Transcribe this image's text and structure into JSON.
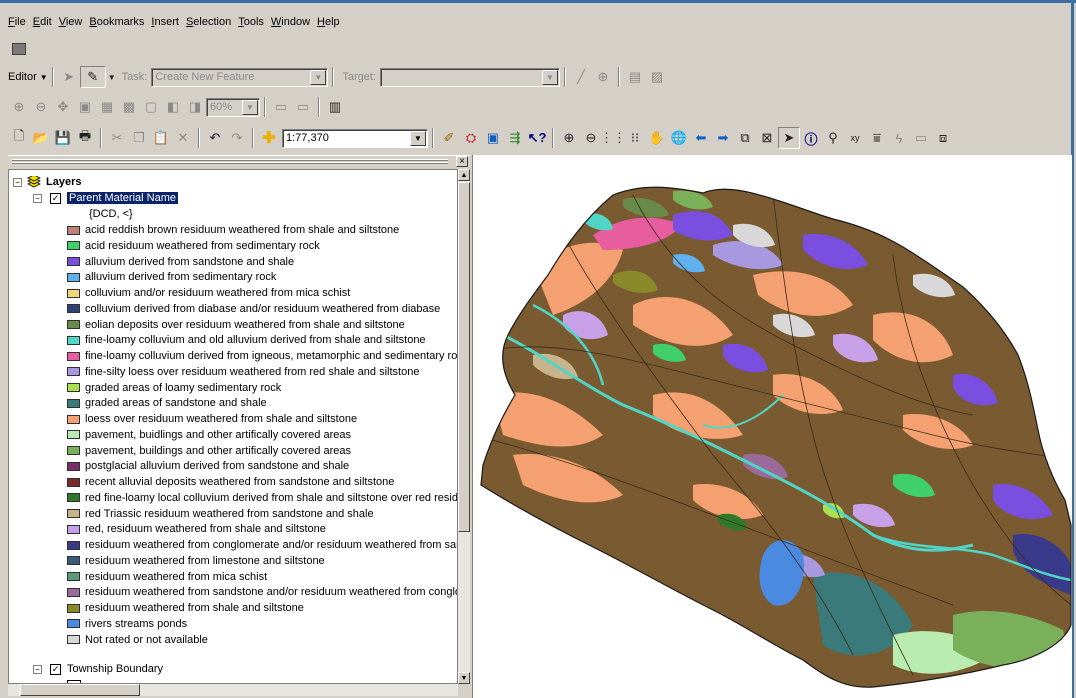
{
  "menu": [
    "File",
    "Edit",
    "View",
    "Bookmarks",
    "Insert",
    "Selection",
    "Tools",
    "Window",
    "Help"
  ],
  "editor_toolbar": {
    "editor_label": "Editor",
    "task_label": "Task:",
    "task_value": "Create New Feature",
    "target_label": "Target:",
    "target_value": ""
  },
  "zoom_combo": {
    "value": "60%"
  },
  "standard_toolbar": {
    "scale_value": "1:77,370"
  },
  "toc": {
    "root_label": "Layers",
    "layer_name": "Parent Material Name",
    "field_label": "{DCD, <}",
    "legend_items": [
      {
        "label": "acid reddish brown residuum weathered from shale and siltstone",
        "color": "#c0807a"
      },
      {
        "label": "acid residuum weathered from sedimentary rock",
        "color": "#3fd06a"
      },
      {
        "label": "alluvium derived from sandstone and shale",
        "color": "#7a4fe0"
      },
      {
        "label": "alluvium derived from sedimentary rock",
        "color": "#5fb0ec"
      },
      {
        "label": "colluvium and/or residuum weathered from mica schist",
        "color": "#f0d67a"
      },
      {
        "label": "colluvium derived from diabase and/or residuum weathered from diabase",
        "color": "#2f3f7a"
      },
      {
        "label": "eolian deposits over residuum weathered from shale and siltstone",
        "color": "#6a8a4a"
      },
      {
        "label": "fine-loamy colluvium and old alluvium derived from shale and siltstone",
        "color": "#4fd6c6"
      },
      {
        "label": "fine-loamy colluvium derived from igneous, metamorphic and sedimentary rock",
        "color": "#e85ca0"
      },
      {
        "label": "fine-silty loess over residuum weathered from red shale and siltstone",
        "color": "#a898e0"
      },
      {
        "label": "graded areas of loamy sedimentary rock",
        "color": "#a8e050"
      },
      {
        "label": "graded areas of sandstone and shale",
        "color": "#3a7a7a"
      },
      {
        "label": "loess over residuum weathered from shale and siltstone",
        "color": "#f4a070"
      },
      {
        "label": "pavement, buidlings and other artifically covered areas",
        "color": "#b8ecb0"
      },
      {
        "label": "pavement, buildings and other artifically covered areas",
        "color": "#7ab05a"
      },
      {
        "label": "postglacial alluvium derived from sandstone and shale",
        "color": "#7a2f6a"
      },
      {
        "label": "recent alluvial deposits weathered from sandstone and siltstone",
        "color": "#7a2a2a"
      },
      {
        "label": "red fine-loamy local colluvium derived from shale and siltstone over red residuu",
        "color": "#2f7a2a"
      },
      {
        "label": "red Triassic residuum weathered from sandstone and shale",
        "color": "#c8b48a"
      },
      {
        "label": "red, residuum weathered from shale and siltstone",
        "color": "#c8a0e8"
      },
      {
        "label": "residuum weathered from conglomerate and/or residuum weathered from sanc",
        "color": "#3a3a8a"
      },
      {
        "label": "residuum weathered from limestone and siltstone",
        "color": "#3a5a7a"
      },
      {
        "label": "residuum weathered from mica schist",
        "color": "#5a9a7a"
      },
      {
        "label": "residuum weathered from sandstone and/or residuum weathered from conglon",
        "color": "#9a6a9a"
      },
      {
        "label": "residuum weathered from shale and siltstone",
        "color": "#8a8a2a"
      },
      {
        "label": "rivers streams ponds",
        "color": "#4a8ae0"
      },
      {
        "label": "Not rated or not available",
        "color": "#d8d8d8"
      }
    ],
    "layer2_name": "Township Boundary"
  },
  "icons": {
    "standard": [
      "new-icon",
      "open-icon",
      "save-icon",
      "print-icon",
      "cut-icon",
      "copy-icon",
      "paste-icon",
      "delete-icon",
      "undo-icon",
      "redo-icon",
      "add-data-icon"
    ],
    "tools": [
      "zoom-in-icon",
      "zoom-out-icon",
      "fixed-zoom-in-icon",
      "fixed-zoom-out-icon",
      "pan-icon",
      "full-extent-icon",
      "back-icon",
      "forward-icon",
      "select-features-icon",
      "clear-selection-icon",
      "select-elements-icon",
      "identify-icon",
      "find-icon",
      "go-to-xy-icon",
      "measure-icon",
      "hyperlink-icon",
      "html-popup-icon",
      "create-viewer-icon"
    ]
  }
}
